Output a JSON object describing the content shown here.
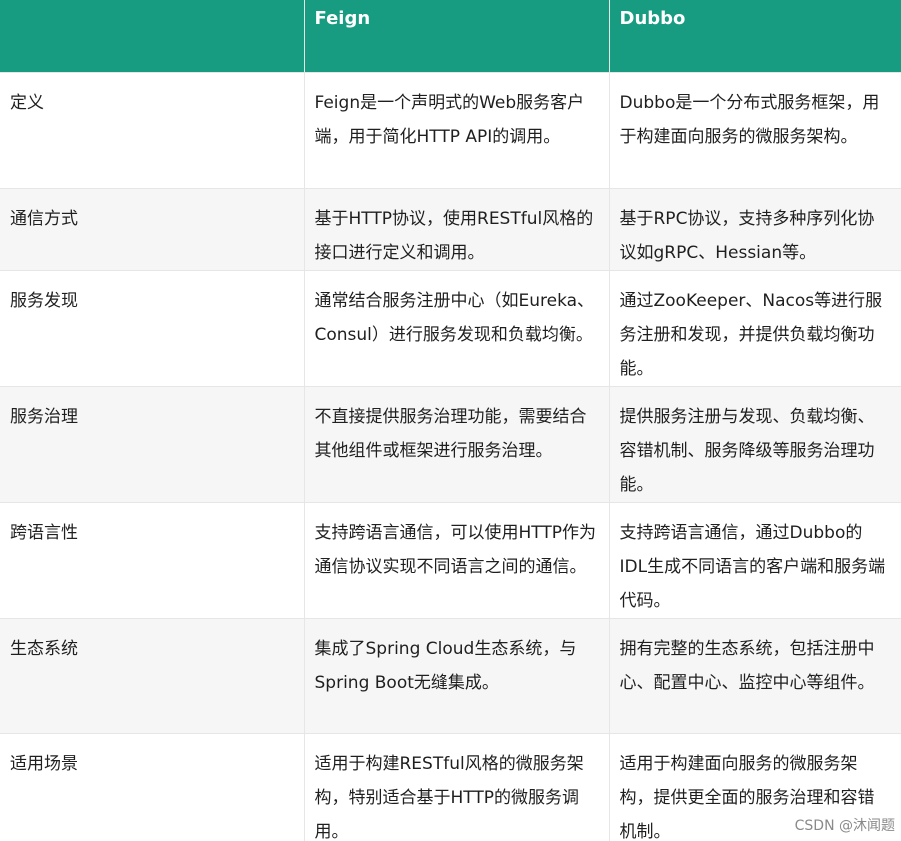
{
  "table": {
    "headers": [
      "",
      "Feign",
      "Dubbo"
    ],
    "rows": [
      {
        "aspect": "定义",
        "feign": "Feign是一个声明式的Web服务客户端，用于简化HTTP API的调用。",
        "dubbo": "Dubbo是一个分布式服务框架，用于构建面向服务的微服务架构。"
      },
      {
        "aspect": "通信方式",
        "feign": "基于HTTP协议，使用RESTful风格的接口进行定义和调用。",
        "dubbo": "基于RPC协议，支持多种序列化协议如gRPC、Hessian等。"
      },
      {
        "aspect": "服务发现",
        "feign": "通常结合服务注册中心（如Eureka、Consul）进行服务发现和负载均衡。",
        "dubbo": "通过ZooKeeper、Nacos等进行服务注册和发现，并提供负载均衡功能。"
      },
      {
        "aspect": "服务治理",
        "feign": "不直接提供服务治理功能，需要结合其他组件或框架进行服务治理。",
        "dubbo": "提供服务注册与发现、负载均衡、容错机制、服务降级等服务治理功能。"
      },
      {
        "aspect": "跨语言性",
        "feign": "支持跨语言通信，可以使用HTTP作为通信协议实现不同语言之间的通信。",
        "dubbo": "支持跨语言通信，通过Dubbo的IDL生成不同语言的客户端和服务端代码。"
      },
      {
        "aspect": "生态系统",
        "feign": "集成了Spring Cloud生态系统，与Spring Boot无缝集成。",
        "dubbo": "拥有完整的生态系统，包括注册中心、配置中心、监控中心等组件。"
      },
      {
        "aspect": "适用场景",
        "feign": "适用于构建RESTful风格的微服务架构，特别适合基于HTTP的微服务调用。",
        "dubbo": "适用于构建面向服务的微服务架构，提供更全面的服务治理和容错机制。"
      }
    ]
  },
  "watermark": "CSDN @沐闻题",
  "colors": {
    "header_bg": "#179c82",
    "header_text": "#ffffff",
    "row_alt_bg": "#f6f6f6",
    "border": "#e6e6e6"
  }
}
